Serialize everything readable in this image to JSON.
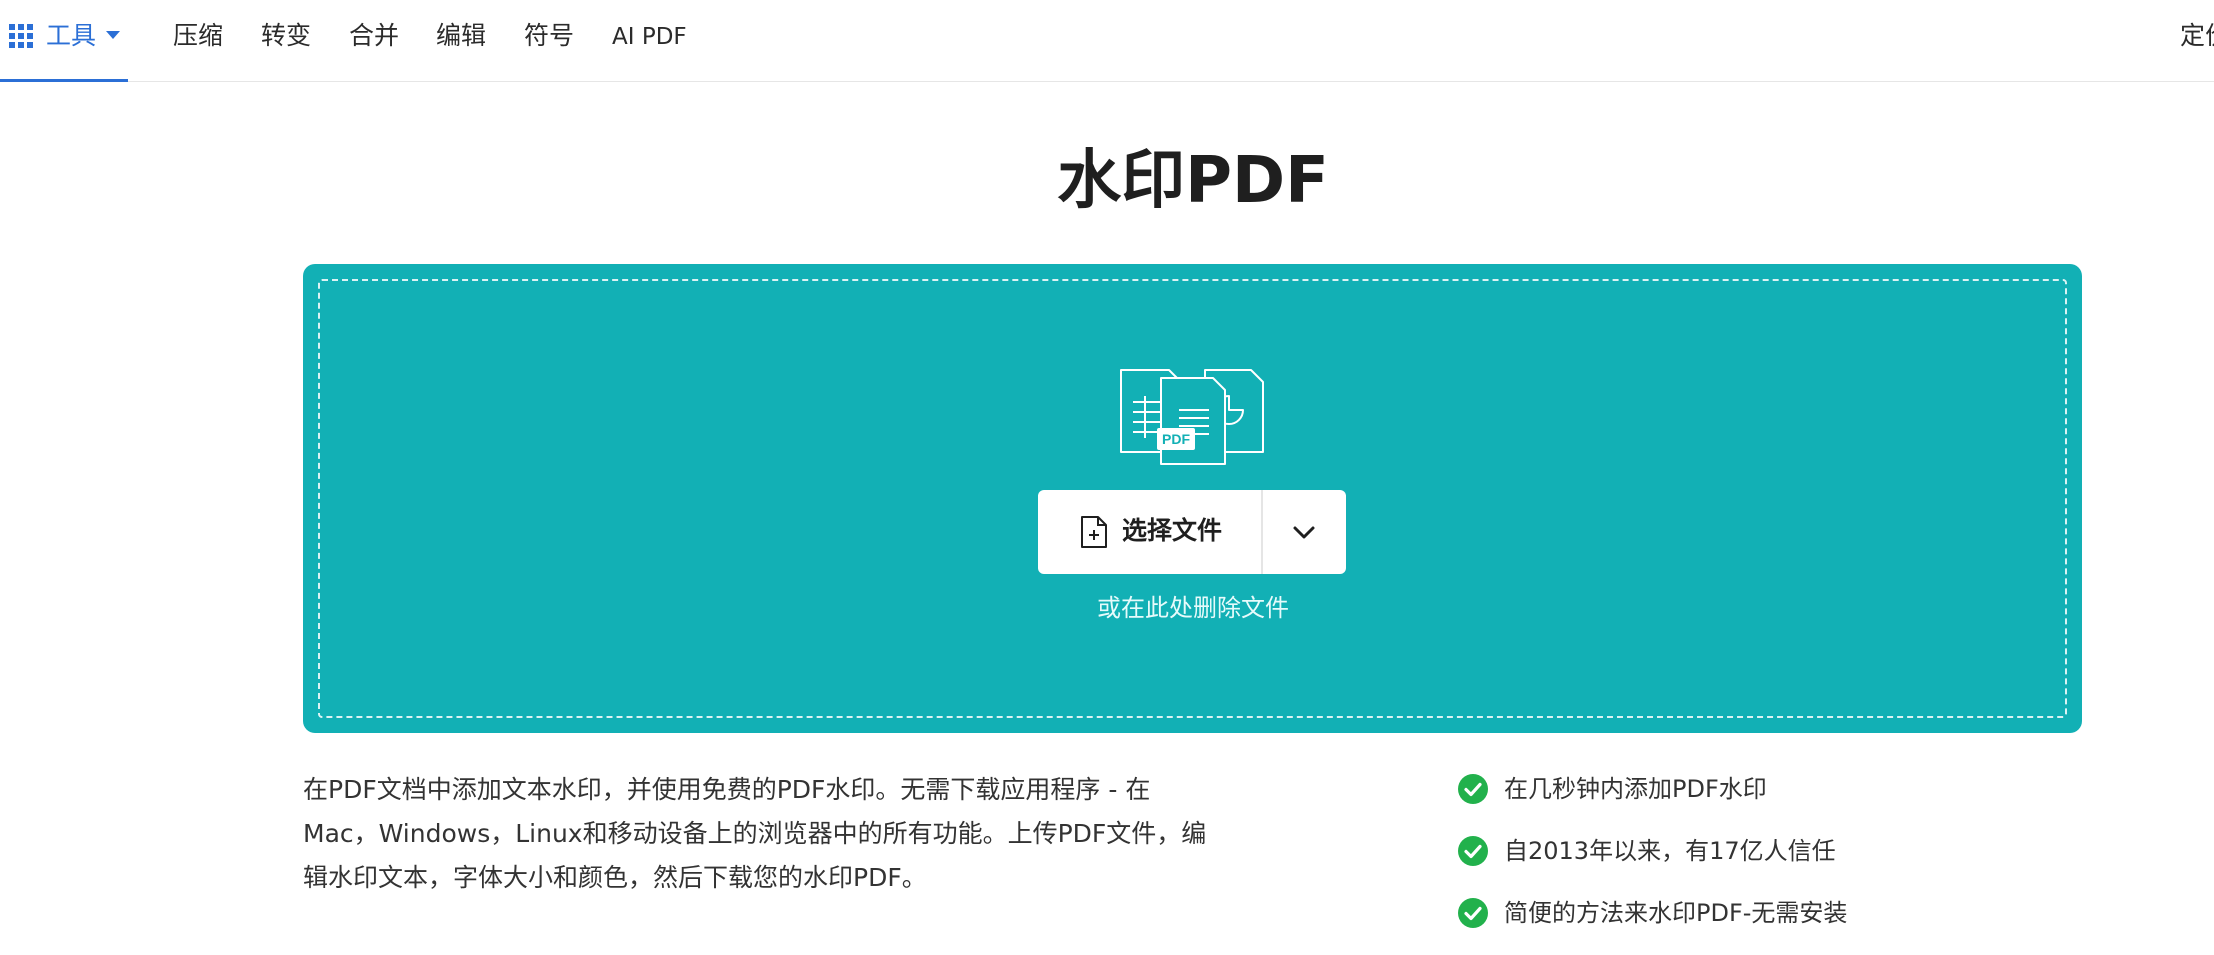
{
  "nav": {
    "tools_label": "工具",
    "items": [
      {
        "label": "压缩"
      },
      {
        "label": "转变"
      },
      {
        "label": "合并"
      },
      {
        "label": "编辑"
      },
      {
        "label": "符号"
      },
      {
        "label": "AI PDF"
      }
    ],
    "right_label": "定价"
  },
  "page": {
    "title": "水印PDF"
  },
  "dropzone": {
    "illustration_label": "PDF",
    "select_label": "选择文件",
    "hint": "或在此处删除文件"
  },
  "description": {
    "text": "在PDF文档中添加文本水印，并使用免费的PDF水印。无需下载应用程序 - 在\nMac，Windows，Linux和移动设备上的浏览器中的所有功能。上传PDF文件，编\n辑水印文本，字体大小和颜色，然后下载您的水印PDF。"
  },
  "features": [
    {
      "label": "在几秒钟内添加PDF水印"
    },
    {
      "label": "自2013年以来，有17亿人信任"
    },
    {
      "label": "简便的方法来水印PDF-无需安装"
    }
  ],
  "colors": {
    "accent": "#2b6fd6",
    "dropzone": "#12b0b5",
    "check": "#22b14c"
  }
}
